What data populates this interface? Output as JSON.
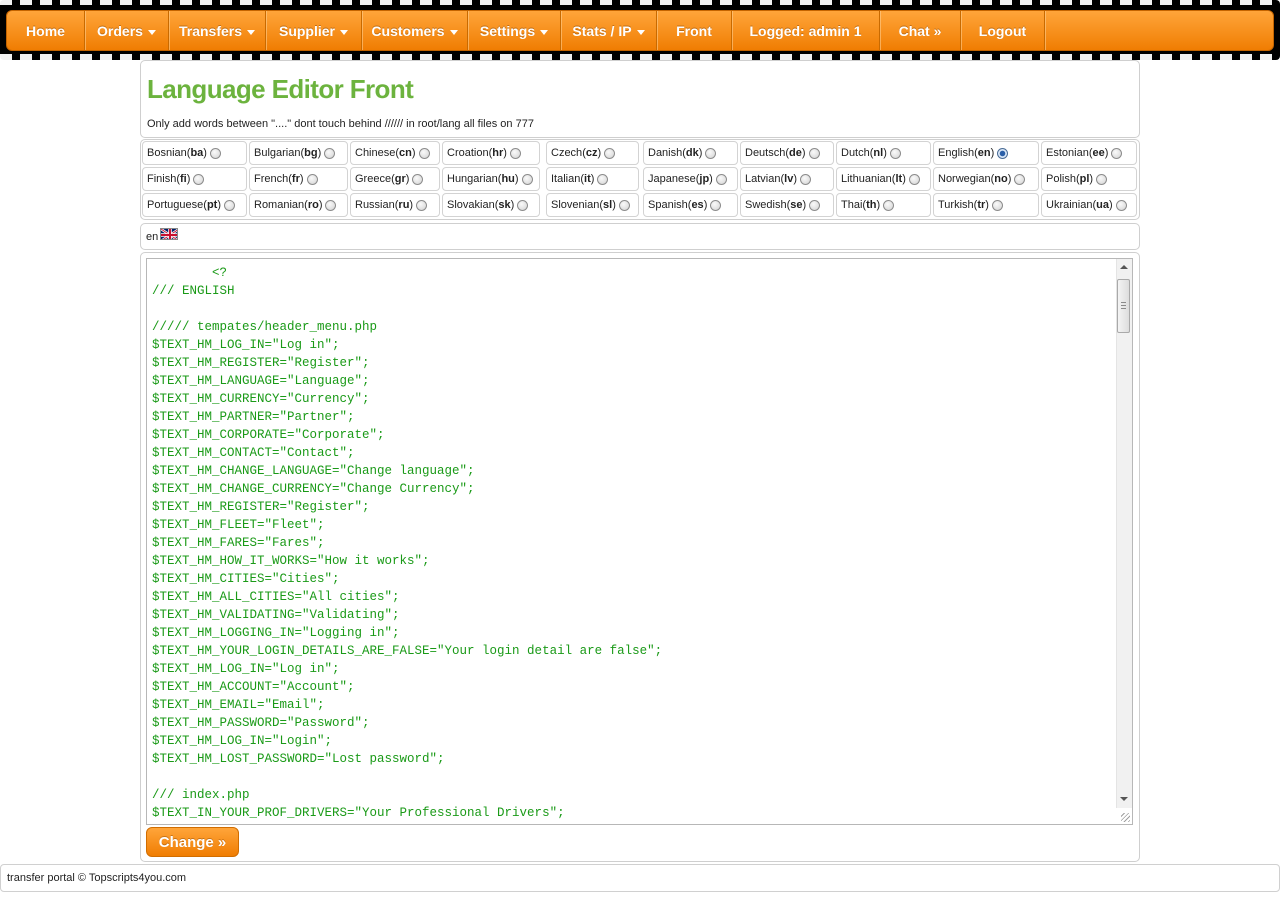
{
  "nav": {
    "items": [
      {
        "label": "Home",
        "dropdown": false
      },
      {
        "label": "Orders",
        "dropdown": true
      },
      {
        "label": "Transfers",
        "dropdown": true
      },
      {
        "label": "Supplier",
        "dropdown": true
      },
      {
        "label": "Customers",
        "dropdown": true
      },
      {
        "label": "Settings",
        "dropdown": true
      },
      {
        "label": "Stats / IP",
        "dropdown": true
      },
      {
        "label": "Front",
        "dropdown": false
      },
      {
        "label": "Logged: admin 1",
        "dropdown": false
      },
      {
        "label": "Chat »",
        "dropdown": false
      },
      {
        "label": "Logout",
        "dropdown": false
      }
    ]
  },
  "header": {
    "title": "Language Editor Front",
    "notice": "Only add words between \"....\" dont touch behind ////// in root/lang all files on 777"
  },
  "languages": [
    {
      "name": "Bosnian",
      "code": "ba",
      "selected": false
    },
    {
      "name": "Bulgarian",
      "code": "bg",
      "selected": false
    },
    {
      "name": "Chinese",
      "code": "cn",
      "selected": false
    },
    {
      "name": "Croation",
      "code": "hr",
      "selected": false
    },
    {
      "name": "Czech",
      "code": "cz",
      "selected": false
    },
    {
      "name": "Danish",
      "code": "dk",
      "selected": false
    },
    {
      "name": "Deutsch",
      "code": "de",
      "selected": false
    },
    {
      "name": "Dutch",
      "code": "nl",
      "selected": false
    },
    {
      "name": "English",
      "code": "en",
      "selected": true
    },
    {
      "name": "Estonian",
      "code": "ee",
      "selected": false
    },
    {
      "name": "Finish",
      "code": "fi",
      "selected": false
    },
    {
      "name": "French",
      "code": "fr",
      "selected": false
    },
    {
      "name": "Greece",
      "code": "gr",
      "selected": false
    },
    {
      "name": "Hungarian",
      "code": "hu",
      "selected": false
    },
    {
      "name": "Italian",
      "code": "it",
      "selected": false
    },
    {
      "name": "Japanese",
      "code": "jp",
      "selected": false
    },
    {
      "name": "Latvian",
      "code": "lv",
      "selected": false
    },
    {
      "name": "Lithuanian",
      "code": "lt",
      "selected": false
    },
    {
      "name": "Norwegian",
      "code": "no",
      "selected": false
    },
    {
      "name": "Polish",
      "code": "pl",
      "selected": false
    },
    {
      "name": "Portuguese",
      "code": "pt",
      "selected": false
    },
    {
      "name": "Romanian",
      "code": "ro",
      "selected": false
    },
    {
      "name": "Russian",
      "code": "ru",
      "selected": false
    },
    {
      "name": "Slovakian",
      "code": "sk",
      "selected": false
    },
    {
      "name": "Slovenian",
      "code": "sl",
      "selected": false
    },
    {
      "name": "Spanish",
      "code": "es",
      "selected": false
    },
    {
      "name": "Swedish",
      "code": "se",
      "selected": false
    },
    {
      "name": "Thai",
      "code": "th",
      "selected": false
    },
    {
      "name": "Turkish",
      "code": "tr",
      "selected": false
    },
    {
      "name": "Ukrainian",
      "code": "ua",
      "selected": false
    }
  ],
  "current_language": {
    "code": "en",
    "flag_icon": "uk-flag-icon"
  },
  "editor": {
    "lines": [
      "        <?",
      "/// ENGLISH",
      "",
      "///// tempates/header_menu.php",
      "$TEXT_HM_LOG_IN=\"Log in\";",
      "$TEXT_HM_REGISTER=\"Register\";",
      "$TEXT_HM_LANGUAGE=\"Language\";",
      "$TEXT_HM_CURRENCY=\"Currency\";",
      "$TEXT_HM_PARTNER=\"Partner\";",
      "$TEXT_HM_CORPORATE=\"Corporate\";",
      "$TEXT_HM_CONTACT=\"Contact\";",
      "$TEXT_HM_CHANGE_LANGUAGE=\"Change language\";",
      "$TEXT_HM_CHANGE_CURRENCY=\"Change Currency\";",
      "$TEXT_HM_REGISTER=\"Register\";",
      "$TEXT_HM_FLEET=\"Fleet\";",
      "$TEXT_HM_FARES=\"Fares\";",
      "$TEXT_HM_HOW_IT_WORKS=\"How it works\";",
      "$TEXT_HM_CITIES=\"Cities\";",
      "$TEXT_HM_ALL_CITIES=\"All cities\";",
      "$TEXT_HM_VALIDATING=\"Validating\";",
      "$TEXT_HM_LOGGING_IN=\"Logging in\";",
      "$TEXT_HM_YOUR_LOGIN_DETAILS_ARE_FALSE=\"Your login detail are false\";",
      "$TEXT_HM_LOG_IN=\"Log in\";",
      "$TEXT_HM_ACCOUNT=\"Account\";",
      "$TEXT_HM_EMAIL=\"Email\";",
      "$TEXT_HM_PASSWORD=\"Password\";",
      "$TEXT_HM_LOG_IN=\"Login\";",
      "$TEXT_HM_LOST_PASSWORD=\"Lost password\";",
      "",
      "/// index.php",
      "$TEXT_IN_YOUR_PROF_DRIVERS=\"Your Professional Drivers\";"
    ]
  },
  "actions": {
    "change_label": "Change »"
  },
  "footer": {
    "text": "transfer portal © Topscripts4you.com"
  },
  "colors": {
    "accent": "#f7901e",
    "title": "#6cb33e",
    "code": "#1a9a17"
  }
}
